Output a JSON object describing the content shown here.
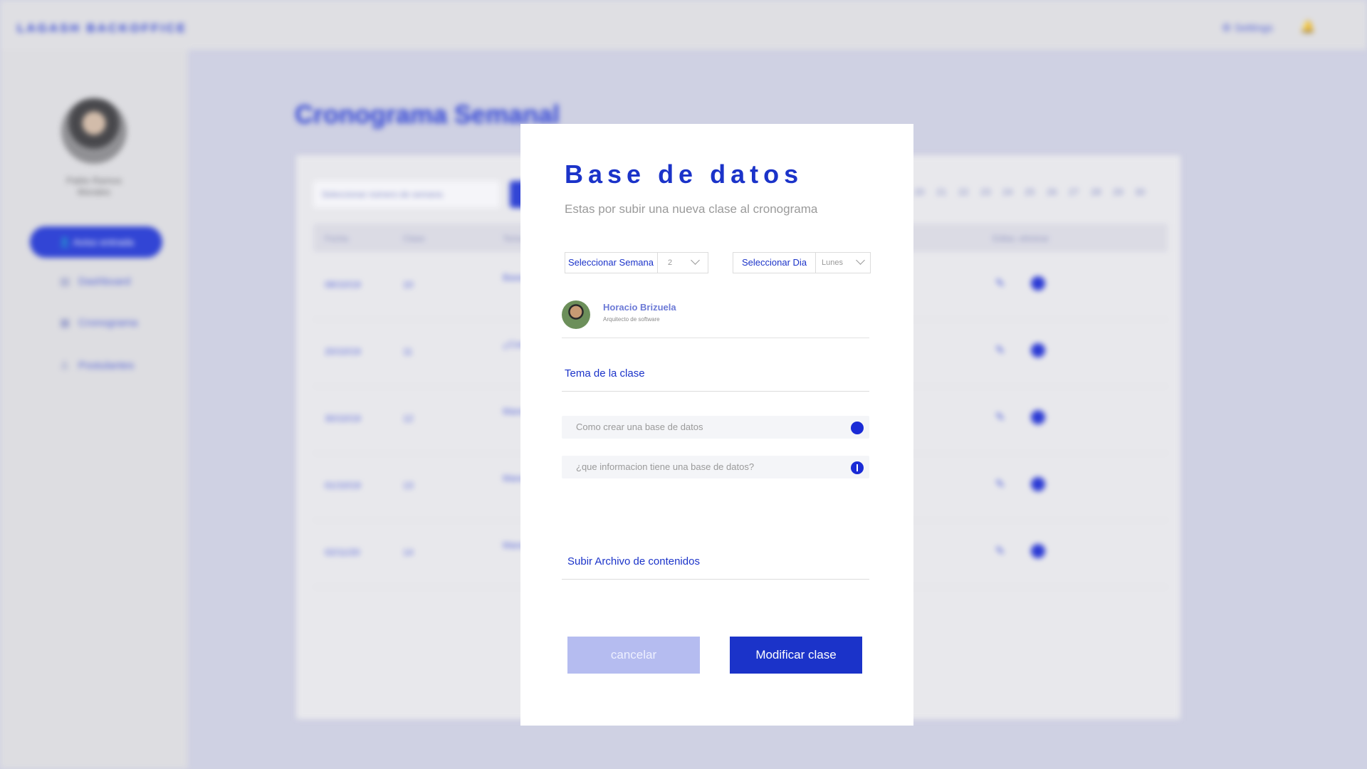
{
  "background": {
    "brand": "LAGASH BACKOFFICE",
    "settings_label": "Settings",
    "user_name": "Pablo Ramos Morales",
    "nav": {
      "primary": "Aviso entrada",
      "items": [
        "Dashboard",
        "Cronograma",
        "Postulantes"
      ]
    },
    "page_title": "Cronograma Semanal",
    "filter_placeholder": "Seleccionar número de semana",
    "days": [
      "20",
      "21",
      "22",
      "23",
      "24",
      "25",
      "26",
      "27",
      "28",
      "29",
      "30"
    ],
    "table_headers": [
      "Fecha",
      "Clase",
      "Tema",
      "Editar, eliminar"
    ],
    "rows": [
      {
        "date": "08/10/19",
        "clase": "10",
        "tema": "Bases de datos"
      },
      {
        "date": "20/10/19",
        "clase": "11",
        "tema": "¿Como crear una base?"
      },
      {
        "date": "30/10/19",
        "clase": "12",
        "tema": "Manejo de datos"
      },
      {
        "date": "01/10/19",
        "clase": "13",
        "tema": "Manejo de datos"
      },
      {
        "date": "02/11/20",
        "clase": "14",
        "tema": "Manejo de datos"
      }
    ]
  },
  "modal": {
    "title": "Base de datos",
    "subtitle": "Estas por subir una nueva clase al cronograma",
    "week_select": {
      "label": "Seleccionar Semana",
      "value": "2"
    },
    "day_select": {
      "label": "Seleccionar Dia",
      "value": "Lunes"
    },
    "instructor": {
      "name": "Horacio Brizuela",
      "role": "Arquitecto de software"
    },
    "topic_label": "Tema de la clase",
    "topics": [
      "Como crear una base de datos",
      "¿que informacion tiene una base de datos?"
    ],
    "upload_label": "Subir Archivo de contenidos",
    "cancel_label": "cancelar",
    "submit_label": "Modificar clase"
  },
  "colors": {
    "accent": "#1b33c9",
    "accent_soft": "#b5bcf0",
    "overlay": "#d4d6e6"
  }
}
